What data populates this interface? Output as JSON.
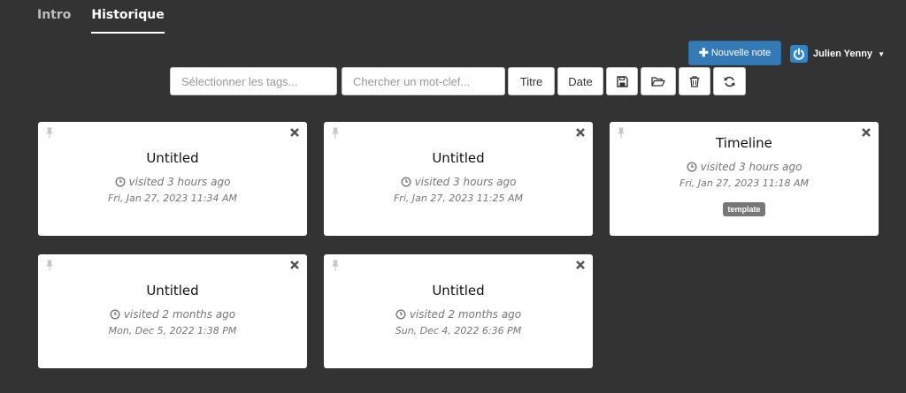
{
  "tabs": [
    {
      "label": "Intro",
      "active": false
    },
    {
      "label": "Historique",
      "active": true
    }
  ],
  "header": {
    "new_note_label": "Nouvelle note",
    "user_name": "Julien Yenny"
  },
  "toolbar": {
    "tags_placeholder": "Sélectionner les tags...",
    "keyword_placeholder": "Chercher un mot-clef...",
    "sort_title_label": "Titre",
    "sort_date_label": "Date",
    "icons": [
      "save-icon",
      "folder-open-icon",
      "trash-icon",
      "refresh-icon"
    ]
  },
  "notes": [
    {
      "title": "Untitled",
      "visited": "visited 3 hours ago",
      "date": "Fri, Jan 27, 2023 11:34 AM",
      "tags": []
    },
    {
      "title": "Untitled",
      "visited": "visited 3 hours ago",
      "date": "Fri, Jan 27, 2023 11:25 AM",
      "tags": []
    },
    {
      "title": "Timeline",
      "visited": "visited 3 hours ago",
      "date": "Fri, Jan 27, 2023 11:18 AM",
      "tags": [
        "template"
      ]
    },
    {
      "title": "Untitled",
      "visited": "visited 2 months ago",
      "date": "Mon, Dec 5, 2022 1:38 PM",
      "tags": []
    },
    {
      "title": "Untitled",
      "visited": "visited 2 months ago",
      "date": "Sun, Dec 4, 2022 6:36 PM",
      "tags": []
    }
  ],
  "colors": {
    "background": "#333333",
    "primary": "#337ab7",
    "tag": "#777777"
  }
}
